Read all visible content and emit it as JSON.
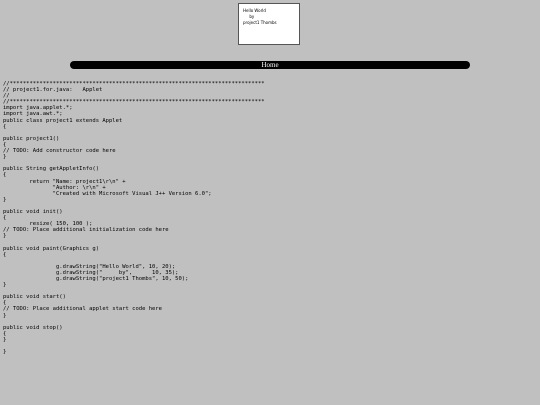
{
  "applet": {
    "lines": [
      "Hello World",
      "     by",
      "project1 Thombs"
    ]
  },
  "nav": {
    "home_label": "Home"
  },
  "source_code": [
    "//*****************************************************************************",
    "// project1.for.java:   Applet",
    "//",
    "//*****************************************************************************",
    "import java.applet.*;",
    "import java.awt.*;",
    "public class project1 extends Applet",
    "{",
    "",
    "public project1()",
    "{",
    "// TODO: Add constructor code here",
    "}",
    "",
    "public String getAppletInfo()",
    "{",
    "        return \"Name: project1\\r\\n\" +",
    "               \"Author: \\r\\n\" +",
    "               \"Created with Microsoft Visual J++ Version 6.0\";",
    "}",
    "",
    "public void init()",
    "{",
    "        resize( 150, 100 );",
    "// TODO: Place additional initialization code here",
    "}",
    "",
    "public void paint(Graphics g)",
    "{",
    "",
    "                g.drawString(\"Hello World\", 10, 20);",
    "                g.drawString(\"     by\",      10, 35);",
    "                g.drawString(\"project1 Thombs\", 10, 50);",
    "}",
    "",
    "public void start()",
    "{",
    "// TODO: Place additional applet start code here",
    "}",
    "",
    "public void stop()",
    "{",
    "}",
    "",
    "}"
  ]
}
